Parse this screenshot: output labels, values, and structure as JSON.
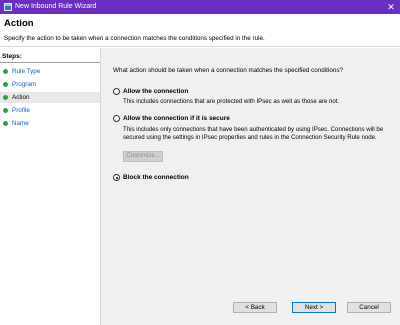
{
  "window": {
    "title": "New Inbound Rule Wizard",
    "close_glyph": "✕",
    "icon": "wizard-app-icon"
  },
  "header": {
    "title": "Action",
    "subtitle": "Specify the action to be taken when a connection matches the conditions specified in the rule."
  },
  "steps": {
    "title": "Steps:",
    "items": [
      {
        "label": "Rule Type",
        "current": false
      },
      {
        "label": "Program",
        "current": false
      },
      {
        "label": "Action",
        "current": true
      },
      {
        "label": "Profile",
        "current": false
      },
      {
        "label": "Name",
        "current": false
      }
    ]
  },
  "main": {
    "question": "What action should be taken when a connection matches the specified conditions?",
    "options": [
      {
        "label": "Allow the connection",
        "description": "This includes connections that are protected with IPsec as well as those are not.",
        "selected": false
      },
      {
        "label": "Allow the connection if it is secure",
        "description": "This includes only connections that have been authenticated by using IPsec.  Connections will be secured using the settings in IPsec properties and rules in the Connection Security Rule node.",
        "selected": false
      },
      {
        "label": "Block the connection",
        "description": "",
        "selected": true
      }
    ],
    "customize_label": "Customize..."
  },
  "buttons": {
    "back": "< Back",
    "next": "Next >",
    "cancel": "Cancel"
  },
  "colors": {
    "titlebar": "#6a2ec2",
    "step_dot": "#2ea043",
    "step_link": "#1a5fb4"
  }
}
